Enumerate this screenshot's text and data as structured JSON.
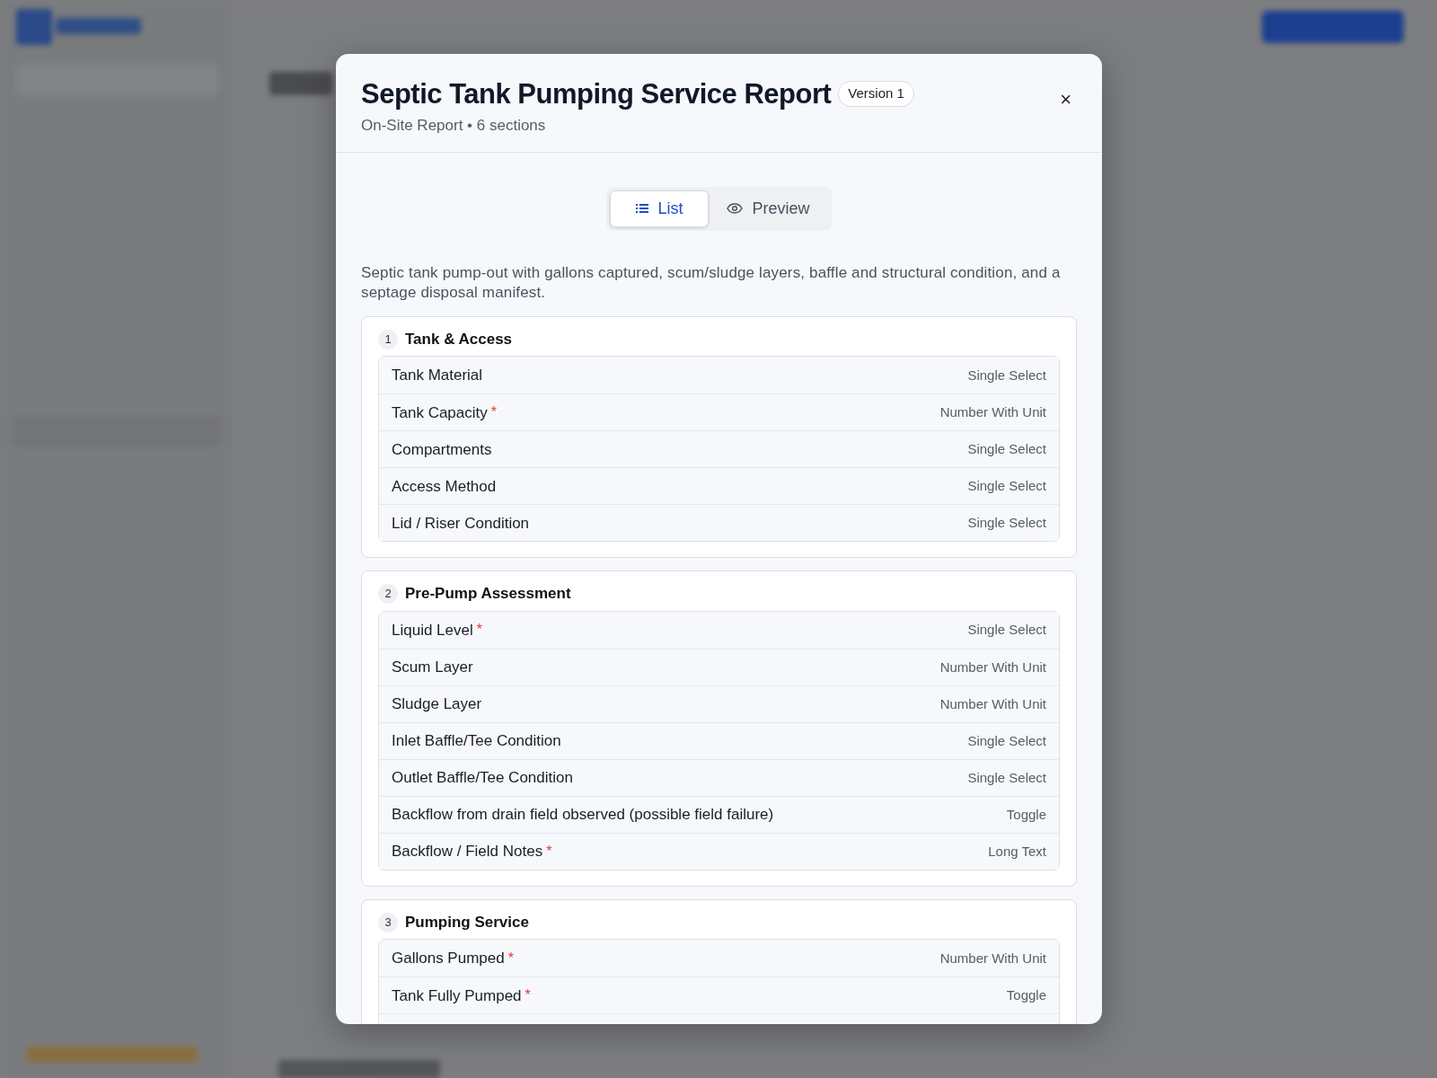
{
  "dialog": {
    "title": "Septic Tank Pumping Service Report",
    "version_badge": "Version 1",
    "subtitle": "On-Site Report • 6 sections",
    "close": "×",
    "view_toggle": [
      {
        "label": "List",
        "selected": true
      },
      {
        "label": "Preview",
        "selected": false
      }
    ],
    "description": "Septic tank pump-out with gallons captured, scum/sludge layers, baffle and structural condition, and a septage disposal manifest.",
    "sections": [
      {
        "number": "1",
        "title": "Tank & Access",
        "fields": [
          {
            "label": "Tank Material",
            "type": "Single Select"
          },
          {
            "label": "Tank Capacity",
            "required_mark": "*",
            "type": "Number With Unit"
          },
          {
            "label": "Compartments",
            "type": "Single Select"
          },
          {
            "label": "Access Method",
            "type": "Single Select"
          },
          {
            "label": "Lid / Riser Condition",
            "type": "Single Select"
          }
        ]
      },
      {
        "number": "2",
        "title": "Pre-Pump Assessment",
        "fields": [
          {
            "label": "Liquid Level",
            "required_mark": "*",
            "type": "Single Select"
          },
          {
            "label": "Scum Layer",
            "type": "Number With Unit"
          },
          {
            "label": "Sludge Layer",
            "type": "Number With Unit"
          },
          {
            "label": "Inlet Baffle/Tee Condition",
            "type": "Single Select"
          },
          {
            "label": "Outlet Baffle/Tee Condition",
            "type": "Single Select"
          },
          {
            "label": "Backflow from drain field observed (possible field failure)",
            "type": "Toggle"
          },
          {
            "label": "Backflow / Field Notes",
            "required_mark": "*",
            "type": "Long Text"
          }
        ]
      },
      {
        "number": "3",
        "title": "Pumping Service",
        "fields": [
          {
            "label": "Gallons Pumped",
            "required_mark": "*",
            "type": "Number With Unit"
          },
          {
            "label": "Tank Fully Pumped",
            "required_mark": "*",
            "type": "Toggle"
          }
        ]
      }
    ]
  }
}
